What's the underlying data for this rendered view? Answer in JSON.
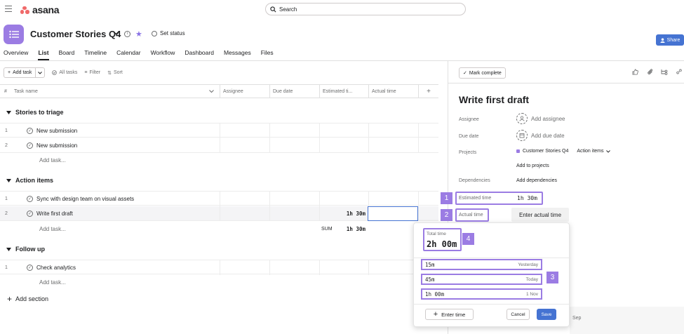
{
  "app": {
    "brand": "asana",
    "search_label": "Search"
  },
  "project": {
    "title": "Customer Stories Q4",
    "set_status": "Set status",
    "share": "Share",
    "accent": "#9b7ce3",
    "tabs": [
      "Overview",
      "List",
      "Board",
      "Timeline",
      "Calendar",
      "Workflow",
      "Dashboard",
      "Messages",
      "Files"
    ],
    "active_tab": "List"
  },
  "toolbar": {
    "add_task": "Add task",
    "all_tasks": "All tasks",
    "filter": "Filter",
    "sort": "Sort"
  },
  "table": {
    "headers": {
      "num": "#",
      "task": "Task name",
      "assignee": "Assignee",
      "due": "Due date",
      "estimated": "Estimated ti...",
      "actual": "Actual time",
      "add": "+"
    },
    "sections": [
      {
        "name": "Stories to triage",
        "rows": [
          {
            "num": "1",
            "name": "New submission"
          },
          {
            "num": "2",
            "name": "New submission"
          }
        ],
        "add_task": "Add task..."
      },
      {
        "name": "Action items",
        "rows": [
          {
            "num": "1",
            "name": "Sync with design team on visual assets"
          },
          {
            "num": "2",
            "name": "Write first draft",
            "estimated": "1h 30m"
          }
        ],
        "add_task": "Add task...",
        "sum_label": "SUM",
        "sum_value": "1h 30m"
      },
      {
        "name": "Follow up",
        "rows": [
          {
            "num": "1",
            "name": "Check analytics"
          }
        ],
        "add_task": "Add task..."
      }
    ],
    "add_section": "Add section"
  },
  "panel": {
    "mark_complete": "Mark complete",
    "task_title": "Write first draft",
    "assignee_label": "Assignee",
    "assignee_value": "Add assignee",
    "due_label": "Due date",
    "due_value": "Add due date",
    "projects_label": "Projects",
    "project_chip": "Customer Stories Q4",
    "action_items": "Action items",
    "add_to_projects": "Add to projects",
    "dependencies_label": "Dependencies",
    "dependencies_value": "Add dependencies",
    "estimated_label": "Estimated time",
    "estimated_value": "1h 30m",
    "actual_label": "Actual time",
    "enter_actual": "Enter actual time",
    "footer_date": "Sep"
  },
  "popup": {
    "total_label": "Total time",
    "total_value": "2h 00m",
    "entries": [
      {
        "amount": "15m",
        "when": "Yesterday"
      },
      {
        "amount": "45m",
        "when": "Today"
      },
      {
        "amount": "1h 00m",
        "when": "1 Nov"
      }
    ],
    "enter_time": "Enter time",
    "cancel": "Cancel",
    "save": "Save"
  },
  "badges": [
    "1",
    "2",
    "3",
    "4"
  ]
}
